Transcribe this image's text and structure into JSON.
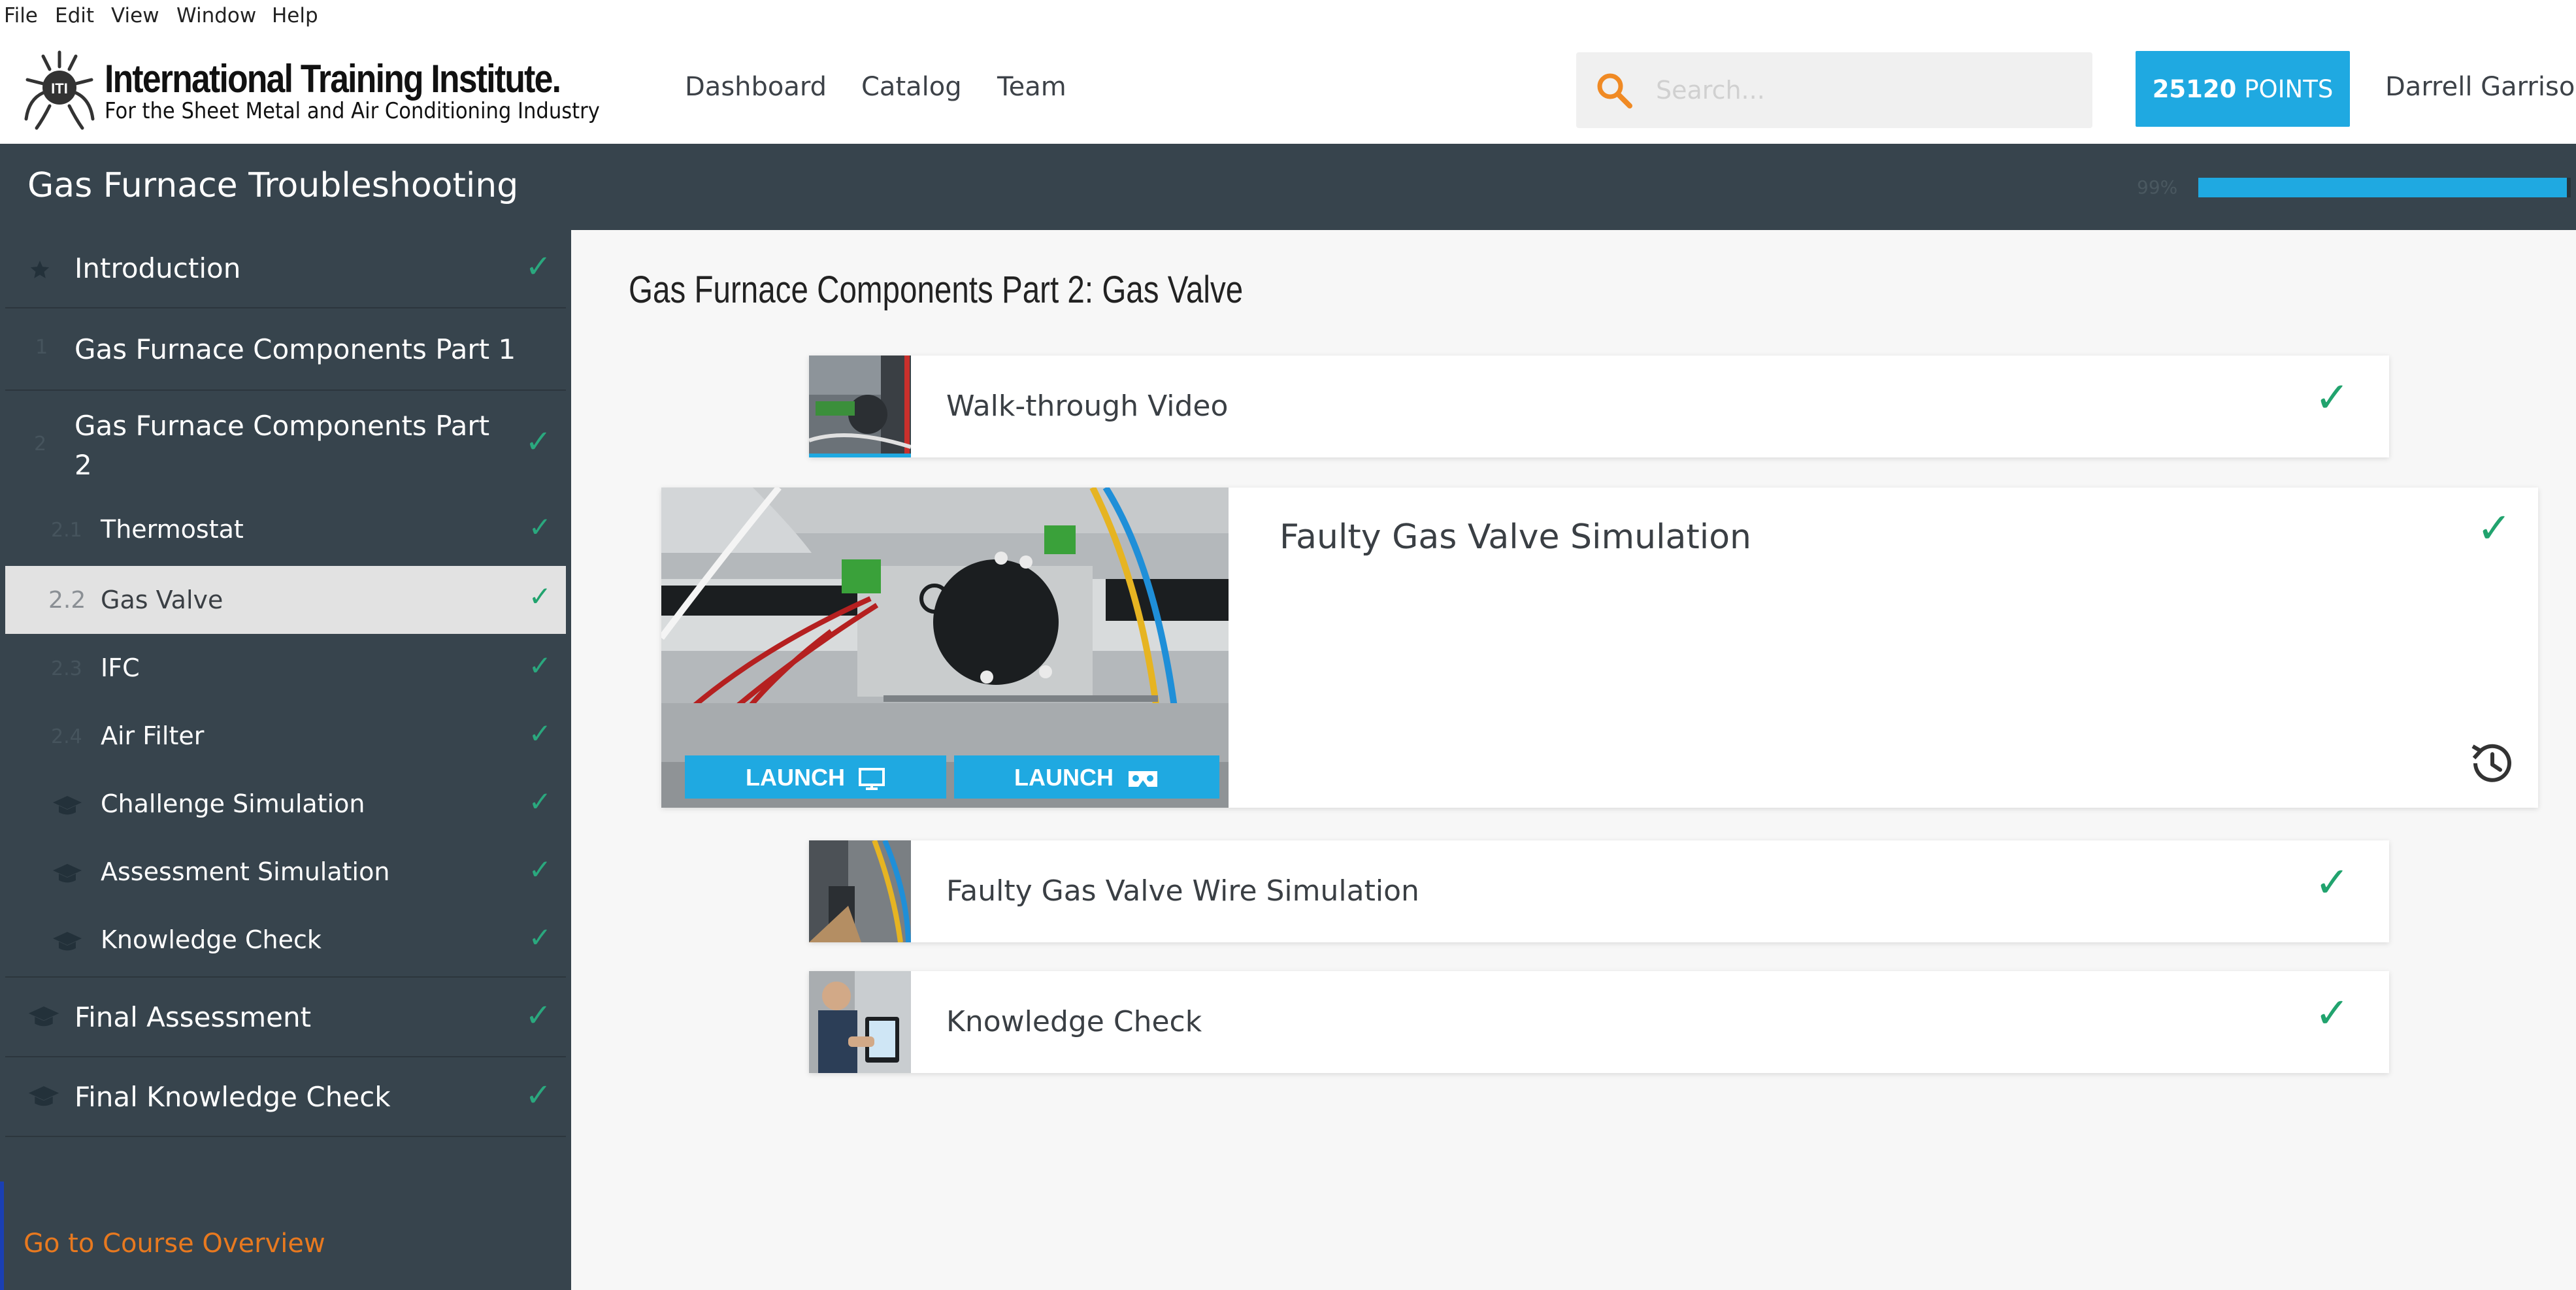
{
  "menubar": {
    "items": [
      "File",
      "Edit",
      "View",
      "Window",
      "Help"
    ]
  },
  "logo": {
    "title": "International Training Institute.",
    "subtitle": "For the Sheet Metal and Air Conditioning Industry",
    "mark_letters": "ITI"
  },
  "nav": {
    "items": [
      "Dashboard",
      "Catalog",
      "Team"
    ]
  },
  "search": {
    "placeholder": "Search..."
  },
  "points": {
    "value": "25120",
    "label": "POINTS"
  },
  "user": {
    "name": "Darrell Garrison"
  },
  "course": {
    "title": "Gas Furnace Troubleshooting",
    "progress_label": "99%",
    "progress_fraction": 0.99
  },
  "sidebar": {
    "items": [
      {
        "num": "",
        "label": "Introduction",
        "type": "main",
        "icon": "star-icon",
        "checked": true
      },
      {
        "num": "1",
        "label": "Gas Furnace Components Part 1",
        "type": "main",
        "icon": "",
        "checked": false
      },
      {
        "num": "2",
        "label": "Gas Furnace Components Part 2",
        "type": "main",
        "icon": "",
        "checked": true
      },
      {
        "num": "2.1",
        "label": "Thermostat",
        "type": "sub",
        "icon": "",
        "checked": true
      },
      {
        "num": "2.2",
        "label": "Gas Valve",
        "type": "sub",
        "icon": "",
        "checked": true,
        "active": true
      },
      {
        "num": "2.3",
        "label": "IFC",
        "type": "sub",
        "icon": "",
        "checked": true
      },
      {
        "num": "2.4",
        "label": "Air Filter",
        "type": "sub",
        "icon": "",
        "checked": true
      },
      {
        "num": "",
        "label": "Challenge Simulation",
        "type": "sub",
        "icon": "graduation-cap-icon",
        "checked": true
      },
      {
        "num": "",
        "label": "Assessment Simulation",
        "type": "sub",
        "icon": "graduation-cap-icon",
        "checked": true
      },
      {
        "num": "",
        "label": "Knowledge Check",
        "type": "sub",
        "icon": "graduation-cap-icon",
        "checked": true
      },
      {
        "num": "",
        "label": "Final Assessment",
        "type": "main",
        "icon": "graduation-cap-icon",
        "checked": true
      },
      {
        "num": "",
        "label": "Final Knowledge Check",
        "type": "main",
        "icon": "graduation-cap-icon",
        "checked": true
      }
    ],
    "overview_link": "Go to Course Overview"
  },
  "main": {
    "section_title": "Gas Furnace Components Part 2: Gas Valve",
    "activities": [
      {
        "title": "Walk-through Video",
        "checked": true
      },
      {
        "title": "Faulty Gas Valve Simulation",
        "checked": true,
        "launch_desktop": "LAUNCH",
        "launch_vr": "LAUNCH"
      },
      {
        "title": "Faulty Gas Valve Wire Simulation",
        "checked": true
      },
      {
        "title": "Knowledge Check",
        "checked": true
      }
    ]
  },
  "colors": {
    "accent": "#1fa9e1",
    "dark_panel": "#37444d",
    "check_green": "#21a36e",
    "link_orange": "#e8791f"
  }
}
